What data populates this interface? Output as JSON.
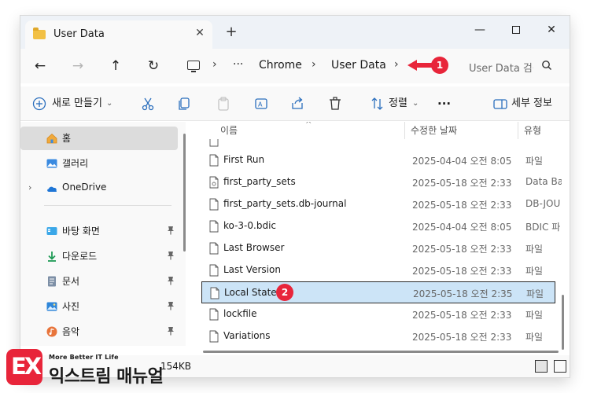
{
  "tab": {
    "title": "User Data",
    "close_label": "✕",
    "new_tab_label": "+"
  },
  "window_controls": {
    "minimize": "—",
    "close": "✕"
  },
  "nav": {
    "back": "←",
    "forward": "→",
    "up": "↑",
    "refresh": "↻"
  },
  "address": {
    "ellipsis": "···",
    "separator": "›",
    "crumbs": [
      "Chrome",
      "User Data"
    ]
  },
  "search": {
    "placeholder": "User Data 검색"
  },
  "toolbar": {
    "new_label": "새로 만들기",
    "sort_label": "정렬",
    "more_label": "···",
    "details_label": "세부 정보"
  },
  "sidebar": {
    "items": [
      {
        "label": "홈",
        "icon": "home-icon"
      },
      {
        "label": "갤러리",
        "icon": "gallery-icon"
      },
      {
        "label": "OneDrive",
        "icon": "cloud-icon"
      },
      {
        "label": "바탕 화면",
        "icon": "desktop-icon"
      },
      {
        "label": "다운로드",
        "icon": "download-icon"
      },
      {
        "label": "문서",
        "icon": "document-icon"
      },
      {
        "label": "사진",
        "icon": "pictures-icon"
      },
      {
        "label": "음악",
        "icon": "music-icon"
      }
    ]
  },
  "columns": {
    "name": "이름",
    "modified": "수정한 날짜",
    "type": "유형"
  },
  "files": [
    {
      "name": "First Run",
      "modified": "2025-04-04 오전 8:05",
      "type": "파일"
    },
    {
      "name": "first_party_sets",
      "modified": "2025-05-18 오전 2:33",
      "type": "Data Ba"
    },
    {
      "name": "first_party_sets.db-journal",
      "modified": "2025-05-18 오전 2:33",
      "type": "DB-JOU"
    },
    {
      "name": "ko-3-0.bdic",
      "modified": "2025-04-04 오전 8:05",
      "type": "BDIC 파"
    },
    {
      "name": "Last Browser",
      "modified": "2025-05-18 오전 2:33",
      "type": "파일"
    },
    {
      "name": "Last Version",
      "modified": "2025-05-18 오전 2:33",
      "type": "파일"
    },
    {
      "name": "Local State",
      "modified": "2025-05-18 오전 2:35",
      "type": "파일"
    },
    {
      "name": "lockfile",
      "modified": "2025-05-18 오전 2:33",
      "type": "파일"
    },
    {
      "name": "Variations",
      "modified": "2025-05-18 오전 2:33",
      "type": "파일"
    }
  ],
  "selected_file": "Local State",
  "status": {
    "text": "154KB"
  },
  "markers": {
    "m1": "1",
    "m2": "2"
  },
  "colors": {
    "accent": "#e8253a",
    "selection": "#cce4f7",
    "folder": "#f2c044"
  },
  "watermark": {
    "small": "More Better IT Life",
    "big": "익스트림 매뉴얼",
    "mark": "EX"
  }
}
